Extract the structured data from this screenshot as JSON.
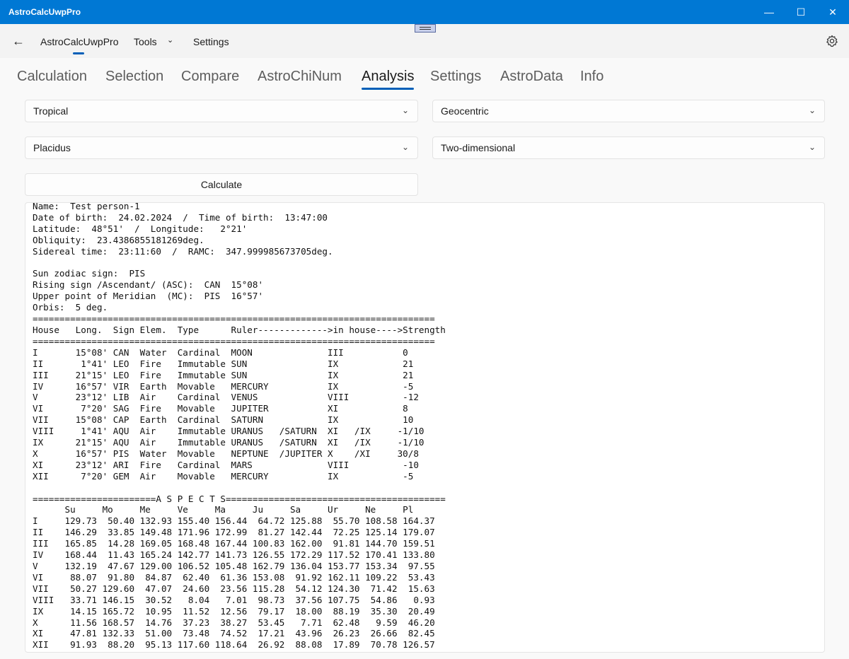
{
  "window": {
    "title": "AstroCalcUwpPro",
    "min": "—",
    "max": "☐",
    "close": "✕"
  },
  "nav": {
    "back": "←",
    "main": "AstroCalcUwpPro",
    "tools": "Tools",
    "settings": "Settings",
    "chevron": "⌄"
  },
  "tabs": [
    "Calculation",
    "Selection",
    "Compare",
    "AstroChiNum",
    "Analysis",
    "Settings",
    "AstroData",
    "Info"
  ],
  "active_tab": "Analysis",
  "combos": {
    "zodiac": "Tropical",
    "centric": "Geocentric",
    "house_system": "Placidus",
    "dimension": "Two-dimensional"
  },
  "caret": "⌄",
  "calculate_label": "Calculate",
  "output_lines": [
    "Name:  Test person-1",
    "Date of birth:  24.02.2024  /  Time of birth:  13:47:00",
    "Latitude:  48°51'  /  Longitude:   2°21'",
    "Obliquity:  23.4386855181269deg.",
    "Sidereal time:  23:11:60  /  RAMC:  347.999985673705deg.",
    "",
    "Sun zodiac sign:  PIS",
    "Rising sign /Ascendant/ (ASC):  CAN  15°08'",
    "Upper point of Meridian  (MC):  PIS  16°57'",
    "Orbis:  5 deg.",
    "===========================================================================",
    "House   Long.  Sign Elem.  Type      Ruler------------->in house---->Strength",
    "===========================================================================",
    "I       15°08' CAN  Water  Cardinal  MOON              III           0",
    "II       1°41' LEO  Fire   Immutable SUN               IX            21",
    "III     21°15' LEO  Fire   Immutable SUN               IX            21",
    "IV      16°57' VIR  Earth  Movable   MERCURY           IX            -5",
    "V       23°12' LIB  Air    Cardinal  VENUS             VIII          -12",
    "VI       7°20' SAG  Fire   Movable   JUPITER           XI            8",
    "VII     15°08' CAP  Earth  Cardinal  SATURN            IX            10",
    "VIII     1°41' AQU  Air    Immutable URANUS   /SATURN  XI   /IX     -1/10",
    "IX      21°15' AQU  Air    Immutable URANUS   /SATURN  XI   /IX     -1/10",
    "X       16°57' PIS  Water  Movable   NEPTUNE  /JUPITER X    /XI     30/8",
    "XI      23°12' ARI  Fire   Cardinal  MARS              VIII          -10",
    "XII      7°20' GEM  Air    Movable   MERCURY           IX            -5",
    "",
    "=======================A S P E C T S=========================================",
    "      Su     Mo     Me     Ve     Ma     Ju     Sa     Ur     Ne     Pl",
    "I     129.73  50.40 132.93 155.40 156.44  64.72 125.88  55.70 108.58 164.37",
    "II    146.29  33.85 149.48 171.96 172.99  81.27 142.44  72.25 125.14 179.07",
    "III   165.85  14.28 169.05 168.48 167.44 100.83 162.00  91.81 144.70 159.51",
    "IV    168.44  11.43 165.24 142.77 141.73 126.55 172.29 117.52 170.41 133.80",
    "V     132.19  47.67 129.00 106.52 105.48 162.79 136.04 153.77 153.34  97.55",
    "VI     88.07  91.80  84.87  62.40  61.36 153.08  91.92 162.11 109.22  53.43",
    "VII    50.27 129.60  47.07  24.60  23.56 115.28  54.12 124.30  71.42  15.63",
    "VIII   33.71 146.15  30.52   8.04   7.01  98.73  37.56 107.75  54.86   0.93",
    "IX     14.15 165.72  10.95  11.52  12.56  79.17  18.00  88.19  35.30  20.49",
    "X      11.56 168.57  14.76  37.23  38.27  53.45   7.71  62.48   9.59  46.20",
    "XI     47.81 132.33  51.00  73.48  74.52  17.21  43.96  26.23  26.66  82.45",
    "XII    91.93  88.20  95.13 117.60 118.64  26.92  88.08  17.89  70.78 126.57"
  ]
}
